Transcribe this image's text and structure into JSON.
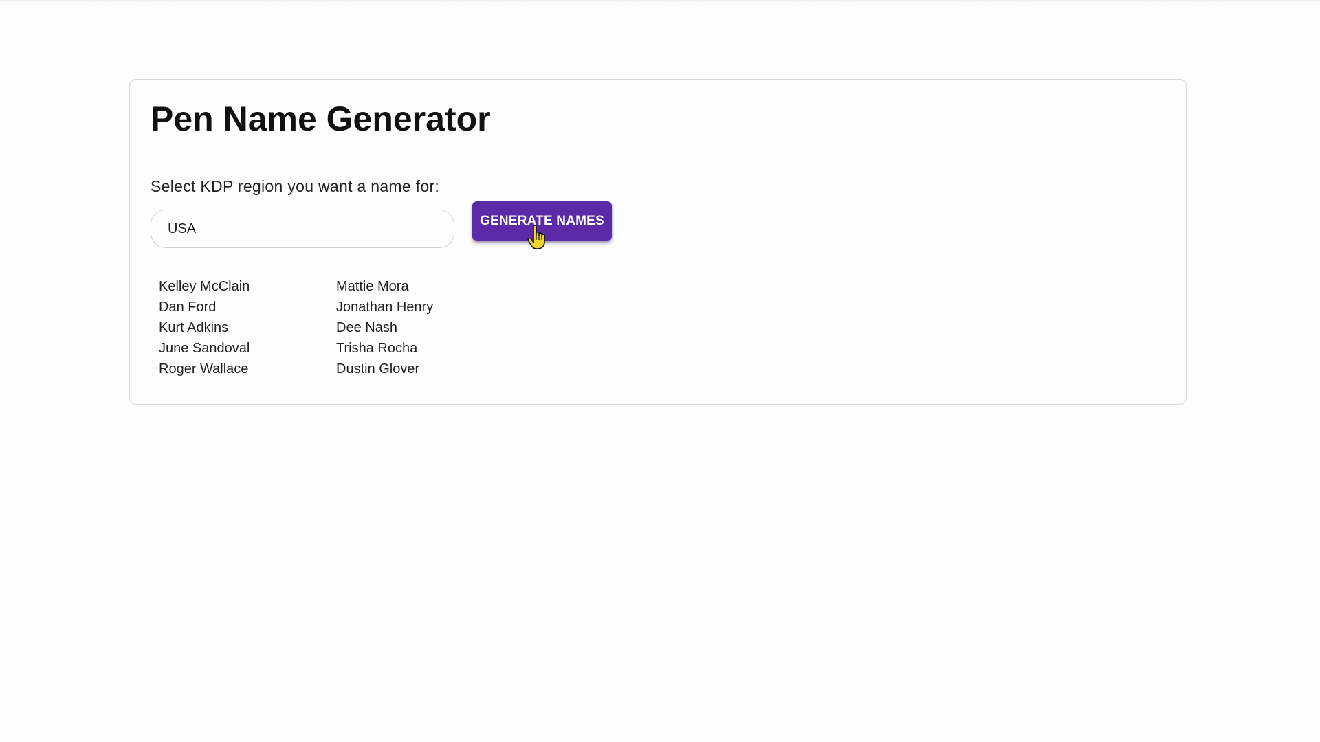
{
  "page": {
    "title": "Pen Name Generator"
  },
  "form": {
    "region_label": "Select KDP region you want a name for:",
    "region_value": "USA",
    "generate_button_label": "GENERATE NAMES"
  },
  "results": {
    "column_1": [
      "Kelley McClain",
      "Dan Ford",
      "Kurt Adkins",
      "June Sandoval",
      "Roger Wallace"
    ],
    "column_2": [
      "Mattie Mora",
      "Jonathan Henry",
      "Dee Nash",
      "Trisha Rocha",
      "Dustin Glover"
    ]
  },
  "colors": {
    "accent": "#5b2aa6",
    "background": "#fdfdfc",
    "card_border": "#d9d9d9"
  },
  "icons": {
    "cursor": "hand-pointer-icon"
  }
}
